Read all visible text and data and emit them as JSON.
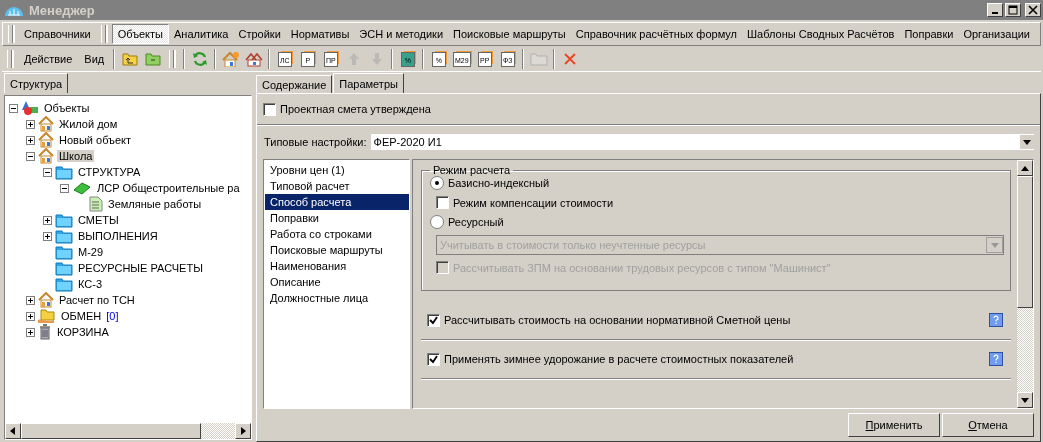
{
  "window": {
    "title": "Менеджер"
  },
  "menu_bands": [
    {
      "items": [
        {
          "label": "Справочники",
          "selected": false
        }
      ]
    },
    {
      "items": [
        {
          "label": "Объекты",
          "selected": true
        },
        {
          "label": "Аналитика",
          "selected": false
        },
        {
          "label": "Стройки",
          "selected": false
        },
        {
          "label": "Нормативы",
          "selected": false
        },
        {
          "label": "ЭСН и методики",
          "selected": false
        },
        {
          "label": "Поисковые маршруты",
          "selected": false
        },
        {
          "label": "Справочник расчётных формул",
          "selected": false
        },
        {
          "label": "Шаблоны Сводных Расчётов",
          "selected": false
        },
        {
          "label": "Поправки",
          "selected": false
        },
        {
          "label": "Организации",
          "selected": false
        }
      ]
    }
  ],
  "toolbar": {
    "menus": [
      "Действие",
      "Вид"
    ],
    "buttons": [
      {
        "kind": "folder-up",
        "disabled": false
      },
      {
        "kind": "folder-minus",
        "disabled": false
      },
      {
        "kind": "separator"
      },
      {
        "kind": "refresh",
        "disabled": false
      },
      {
        "kind": "separator"
      },
      {
        "kind": "house",
        "disabled": false
      },
      {
        "kind": "houses",
        "disabled": false
      },
      {
        "kind": "separator"
      },
      {
        "kind": "doc",
        "label": "ЛС",
        "disabled": false
      },
      {
        "kind": "doc",
        "label": "Р",
        "disabled": false
      },
      {
        "kind": "doc",
        "label": "ПР",
        "disabled": false
      },
      {
        "kind": "arrow-up",
        "disabled": true
      },
      {
        "kind": "arrow-down",
        "disabled": true
      },
      {
        "kind": "separator"
      },
      {
        "kind": "doc",
        "label": "%",
        "disabled": false,
        "color": "#3aa08a"
      },
      {
        "kind": "separator"
      },
      {
        "kind": "doc",
        "label": "%",
        "disabled": false
      },
      {
        "kind": "doc",
        "label": "М29",
        "disabled": false
      },
      {
        "kind": "doc",
        "label": "РР",
        "disabled": false
      },
      {
        "kind": "doc",
        "label": "ФЗ",
        "disabled": false
      },
      {
        "kind": "separator"
      },
      {
        "kind": "folder",
        "disabled": true
      },
      {
        "kind": "separator"
      },
      {
        "kind": "delete",
        "disabled": false
      }
    ]
  },
  "left_tabs": [
    {
      "label": "Структура",
      "selected": true
    }
  ],
  "tree": [
    {
      "label": "Объекты",
      "kind": "root",
      "expanded": true,
      "selected": false,
      "children": [
        {
          "label": "Жилой дом",
          "kind": "house",
          "expanded": false,
          "selected": false
        },
        {
          "label": "Новый объект",
          "kind": "house",
          "expanded": false,
          "selected": false
        },
        {
          "label": "Школа",
          "kind": "house",
          "expanded": true,
          "selected": true,
          "children": [
            {
              "label": "СТРУКТУРА",
              "kind": "folder",
              "expanded": true,
              "selected": false,
              "children": [
                {
                  "label": "ЛСР Общестроительные ра",
                  "kind": "book",
                  "expanded": true,
                  "selected": false,
                  "children": [
                    {
                      "label": "Земляные работы",
                      "kind": "doc",
                      "selected": false
                    }
                  ]
                }
              ]
            },
            {
              "label": "СМЕТЫ",
              "kind": "folder",
              "expanded": false,
              "selected": false
            },
            {
              "label": "ВЫПОЛНЕНИЯ",
              "kind": "folder",
              "expanded": false,
              "selected": false
            },
            {
              "label": "М-29",
              "kind": "folder",
              "selected": false
            },
            {
              "label": "РЕСУРСНЫЕ РАСЧЕТЫ",
              "kind": "folder",
              "selected": false
            },
            {
              "label": "КС-3",
              "kind": "folder",
              "selected": false
            }
          ]
        },
        {
          "label": "Расчет по ТСН",
          "kind": "house",
          "expanded": false,
          "selected": false
        },
        {
          "label": "ОБМЕН",
          "count": "[0]",
          "kind": "exchange",
          "expanded": false,
          "selected": false
        },
        {
          "label": "КОРЗИНА",
          "kind": "trash",
          "expanded": false,
          "selected": false
        }
      ]
    }
  ],
  "content_tabs": [
    {
      "label": "Содержание",
      "selected": false
    },
    {
      "label": "Параметры",
      "selected": true
    }
  ],
  "approved": {
    "label": "Проектная смета утверждена",
    "checked": false
  },
  "typical": {
    "label": "Типовые настройки:",
    "value": "ФЕР-2020 И1"
  },
  "sections": [
    {
      "label": "Уровни цен (1)",
      "selected": false
    },
    {
      "label": "Типовой расчет",
      "selected": false
    },
    {
      "label": "Способ расчета",
      "selected": true
    },
    {
      "label": "Поправки",
      "selected": false
    },
    {
      "label": "Работа со строками",
      "selected": false
    },
    {
      "label": "Поисковые маршруты",
      "selected": false
    },
    {
      "label": "Наименования",
      "selected": false
    },
    {
      "label": "Описание",
      "selected": false
    },
    {
      "label": "Должностные лица",
      "selected": false
    }
  ],
  "calc_mode": {
    "title": "Режим расчета",
    "options": [
      {
        "kind": "radio",
        "label": "Базисно-индексный",
        "selected": true,
        "disabled": false
      },
      {
        "kind": "checkbox",
        "label": "Режим компенсации стоимости",
        "checked": false,
        "disabled": false
      },
      {
        "kind": "radio",
        "label": "Ресурсный",
        "selected": false,
        "disabled": false
      },
      {
        "kind": "select",
        "value": "Учитывать в стоимости только неучтенные ресурсы",
        "disabled": true
      },
      {
        "kind": "checkbox",
        "label": "Рассчитывать ЗПМ на основании трудовых ресурсов с типом \"Машинист\"",
        "checked": false,
        "disabled": true
      }
    ]
  },
  "options": [
    {
      "label": "Рассчитывать стоимость на основании нормативной Сметной цены",
      "checked": true
    },
    {
      "label": "Применять зимнее удорожание в расчете стоимостных показателей",
      "checked": true
    }
  ],
  "buttons": [
    "Применить",
    "Отмена"
  ]
}
